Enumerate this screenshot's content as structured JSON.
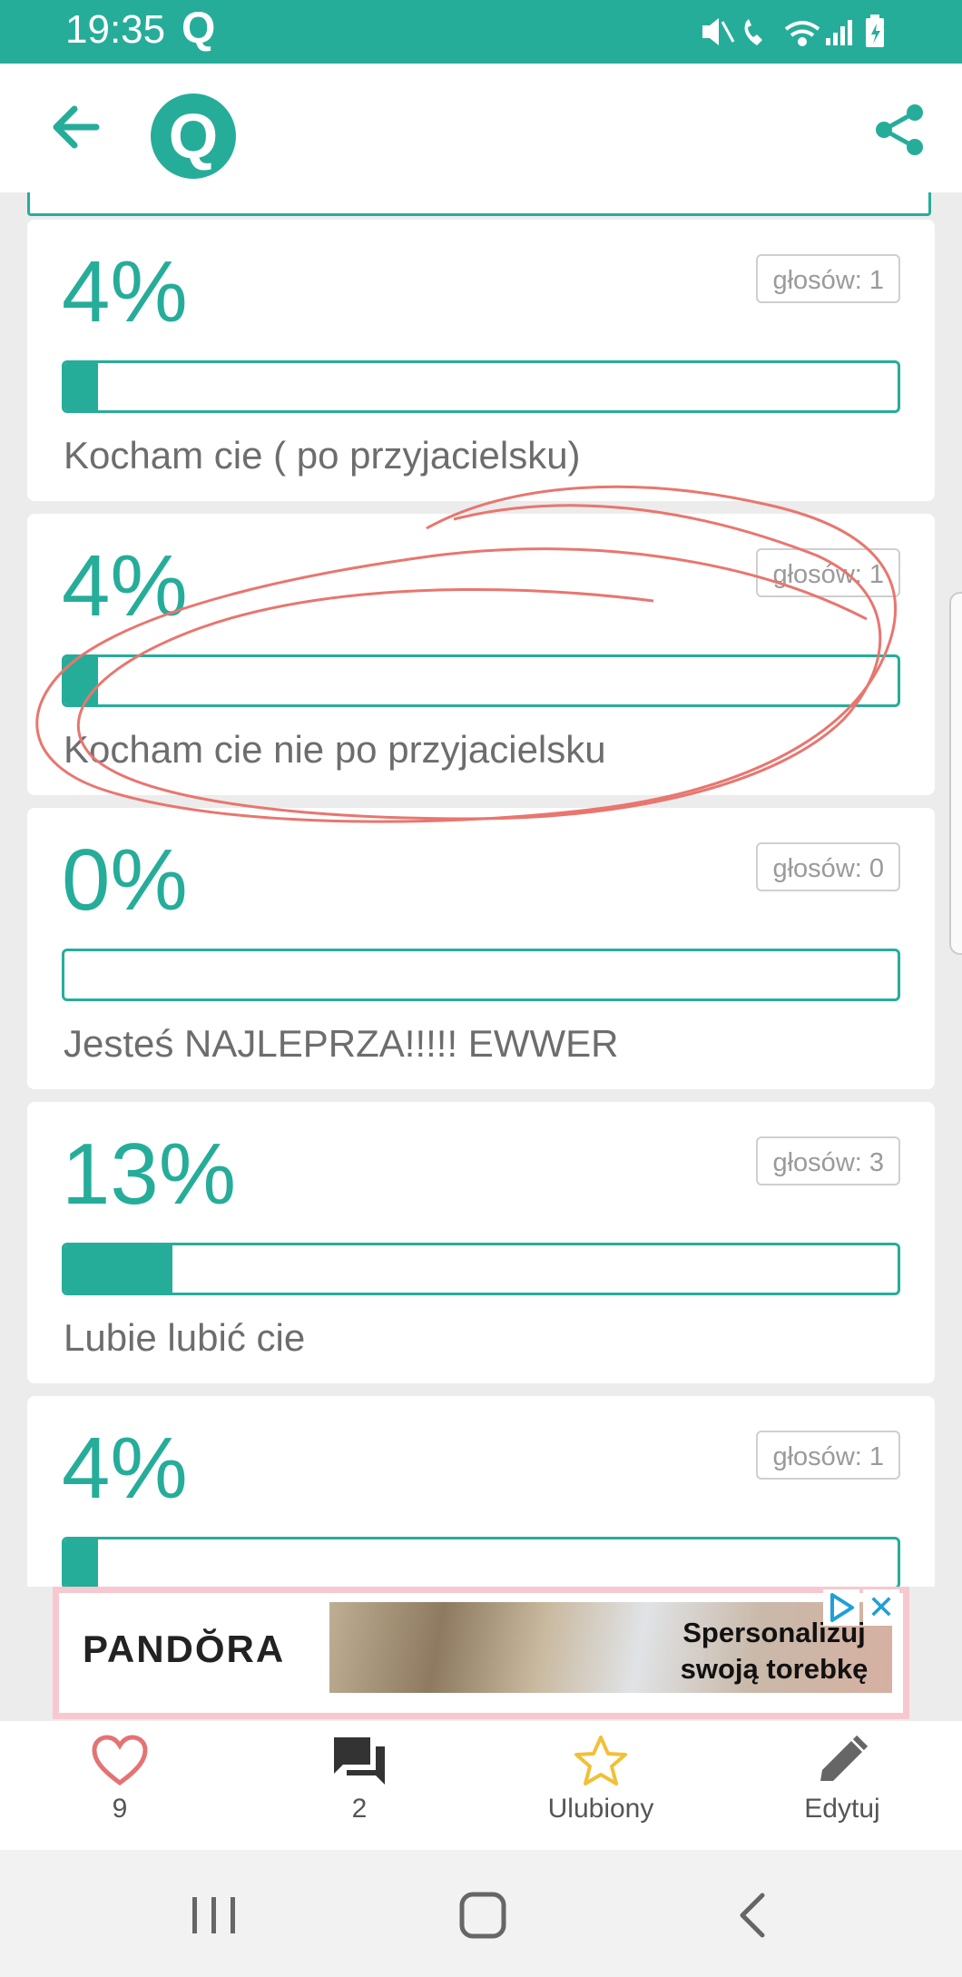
{
  "status_bar": {
    "time": "19:35",
    "app_indicator": "Q"
  },
  "app_bar": {
    "logo_letter": "Q"
  },
  "poll_options": [
    {
      "percent": "4%",
      "votes": "głosów: 1",
      "fraction": 0.04,
      "label": "Kocham cie ( po przyjacielsku)"
    },
    {
      "percent": "4%",
      "votes": "głosów: 1",
      "fraction": 0.04,
      "label": "Kocham cie nie po przyjacielsku"
    },
    {
      "percent": "0%",
      "votes": "głosów: 0",
      "fraction": 0.0,
      "label": "Jesteś NAJLEPRZA!!!!! EWWER"
    },
    {
      "percent": "13%",
      "votes": "głosów: 3",
      "fraction": 0.13,
      "label": "Lubie lubić cie"
    },
    {
      "percent": "4%",
      "votes": "głosów: 1",
      "fraction": 0.04,
      "label": ""
    }
  ],
  "ad": {
    "brand": "PANDŎRA",
    "text_line1": "Spersonalizuj",
    "text_line2": "swoją torebkę",
    "close_symbol": "✕"
  },
  "bottom_nav": {
    "likes": {
      "icon": "heart-icon",
      "label": "9"
    },
    "comments": {
      "icon": "comments-icon",
      "label": "2"
    },
    "favorite": {
      "icon": "star-icon",
      "label": "Ulubiony"
    },
    "edit": {
      "icon": "pencil-icon",
      "label": "Edytuj"
    }
  },
  "colors": {
    "accent": "#26ad9a",
    "heart": "#e57373",
    "star": "#f2c037",
    "annotation": "#e8766f"
  }
}
